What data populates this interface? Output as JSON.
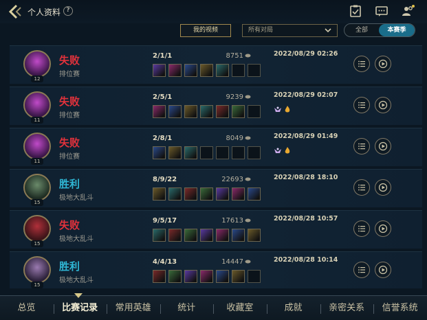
{
  "header": {
    "title": "个人资料",
    "help": "?"
  },
  "filters": {
    "video_label": "我的视频",
    "mode_selected": "所有对局",
    "season_all": "全部",
    "season_current": "本赛季"
  },
  "colors": {
    "loss": "#e2323c",
    "win": "#2fb6d4",
    "accent_gold": "#c8b98a",
    "toggle_active": "#1a6d8a"
  },
  "matches": [
    {
      "result": "失败",
      "outcome": "loss",
      "mode": "排位赛",
      "kda": "2/1/1",
      "gold": "8751",
      "date": "2022/08/29 02:26",
      "level": "12",
      "items_filled": 5,
      "badges": []
    },
    {
      "result": "失败",
      "outcome": "loss",
      "mode": "排位赛",
      "kda": "2/5/1",
      "gold": "9239",
      "date": "2022/08/29 02:07",
      "level": "11",
      "items_filled": 6,
      "badges": [
        "wing-badge-icon",
        "flame-badge-icon"
      ]
    },
    {
      "result": "失败",
      "outcome": "loss",
      "mode": "排位赛",
      "kda": "2/8/1",
      "gold": "8049",
      "date": "2022/08/29 01:49",
      "level": "11",
      "items_filled": 3,
      "badges": [
        "wing-badge-icon",
        "flame-badge-icon"
      ]
    },
    {
      "result": "胜利",
      "outcome": "win",
      "mode": "极地大乱斗",
      "kda": "8/9/22",
      "gold": "22693",
      "date": "2022/08/28 18:10",
      "level": "15",
      "items_filled": 7,
      "badges": []
    },
    {
      "result": "失败",
      "outcome": "loss",
      "mode": "极地大乱斗",
      "kda": "9/5/17",
      "gold": "17613",
      "date": "2022/08/28 10:57",
      "level": "15",
      "items_filled": 7,
      "badges": []
    },
    {
      "result": "胜利",
      "outcome": "win",
      "mode": "极地大乱斗",
      "kda": "4/4/13",
      "gold": "14447",
      "date": "2022/08/28 10:14",
      "level": "15",
      "items_filled": 6,
      "badges": []
    }
  ],
  "nav": {
    "tabs": [
      {
        "label": "总览"
      },
      {
        "label": "比赛记录"
      },
      {
        "label": "常用英雄"
      },
      {
        "label": "统计"
      },
      {
        "label": "收藏室"
      },
      {
        "label": "成就"
      },
      {
        "label": "亲密关系"
      },
      {
        "label": "信誉系统"
      }
    ],
    "active": "比赛记录"
  },
  "icons": [
    "back-arrow-icon",
    "help-icon",
    "clipboard-icon",
    "chat-icon",
    "friends-icon",
    "chevron-down-icon",
    "coin-icon",
    "list-icon",
    "play-icon"
  ]
}
